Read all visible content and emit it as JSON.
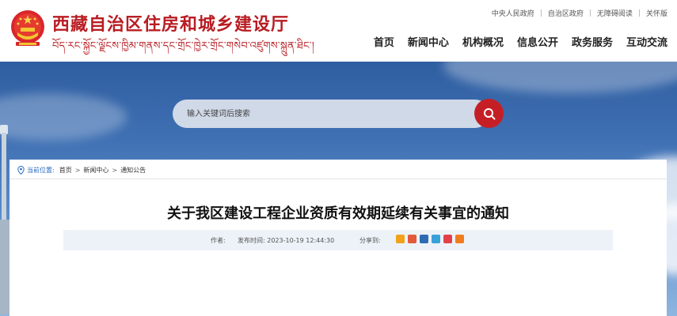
{
  "header": {
    "title": "西藏自治区住房和城乡建设厅",
    "subtitle": "བོད་རང་སྐྱོང་ལྗོངས་ཁྱིམ་གནས་དང་གྲོང་ཁྱེར་གྲོང་གསེབ་འཛུགས་སྐྲུན་ཐིང་།",
    "top_links": [
      "中央人民政府",
      "自治区政府",
      "无障碍阅读",
      "关怀版"
    ],
    "nav": [
      "首页",
      "新闻中心",
      "机构概况",
      "信息公开",
      "政务服务",
      "互动交流"
    ]
  },
  "search": {
    "placeholder": "输入关键词后搜索"
  },
  "breadcrumb": {
    "label": "当前位置:",
    "items": [
      "首页",
      "新闻中心",
      "通知公告"
    ],
    "separator": ">"
  },
  "article": {
    "title": "关于我区建设工程企业资质有效期延续有关事宜的通知",
    "author_label": "作者:",
    "date_label": "发布时间: 2023-10-19 12:44:30",
    "share_label": "分享到:"
  },
  "share_icons": [
    {
      "name": "qzone-icon",
      "color": "#f0a21b"
    },
    {
      "name": "weibo-icon",
      "color": "#e25a3b"
    },
    {
      "name": "renren-icon",
      "color": "#2d6bb5"
    },
    {
      "name": "tencent-weibo-icon",
      "color": "#3aa0d8"
    },
    {
      "name": "douban-icon",
      "color": "#e3414a"
    },
    {
      "name": "more-share-icon",
      "color": "#f07d1c"
    }
  ],
  "colors": {
    "brand_red": "#b81c22",
    "search_button": "#c51f26",
    "breadcrumb_accent": "#2a6bbf"
  }
}
